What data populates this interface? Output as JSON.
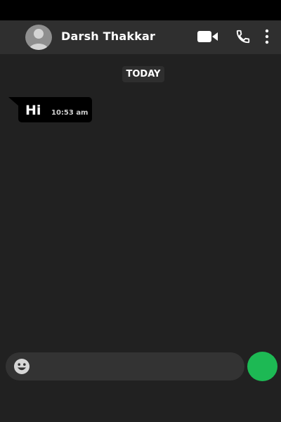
{
  "header": {
    "contact_name": "Darsh Thakkar",
    "avatar_icon": "default-avatar-icon",
    "actions": [
      "video-call-icon",
      "phone-call-icon",
      "more-options-icon"
    ]
  },
  "conversation": {
    "date_label": "TODAY",
    "messages": [
      {
        "text": "Hi",
        "time": "10:53 am"
      }
    ]
  },
  "composer": {
    "placeholder": "",
    "emoji_icon": "emoji-icon",
    "send_button_color": "#1db954"
  },
  "colors": {
    "background": "#212121",
    "header": "#2f2f2f",
    "bubble": "#000000",
    "accent": "#1db954"
  }
}
